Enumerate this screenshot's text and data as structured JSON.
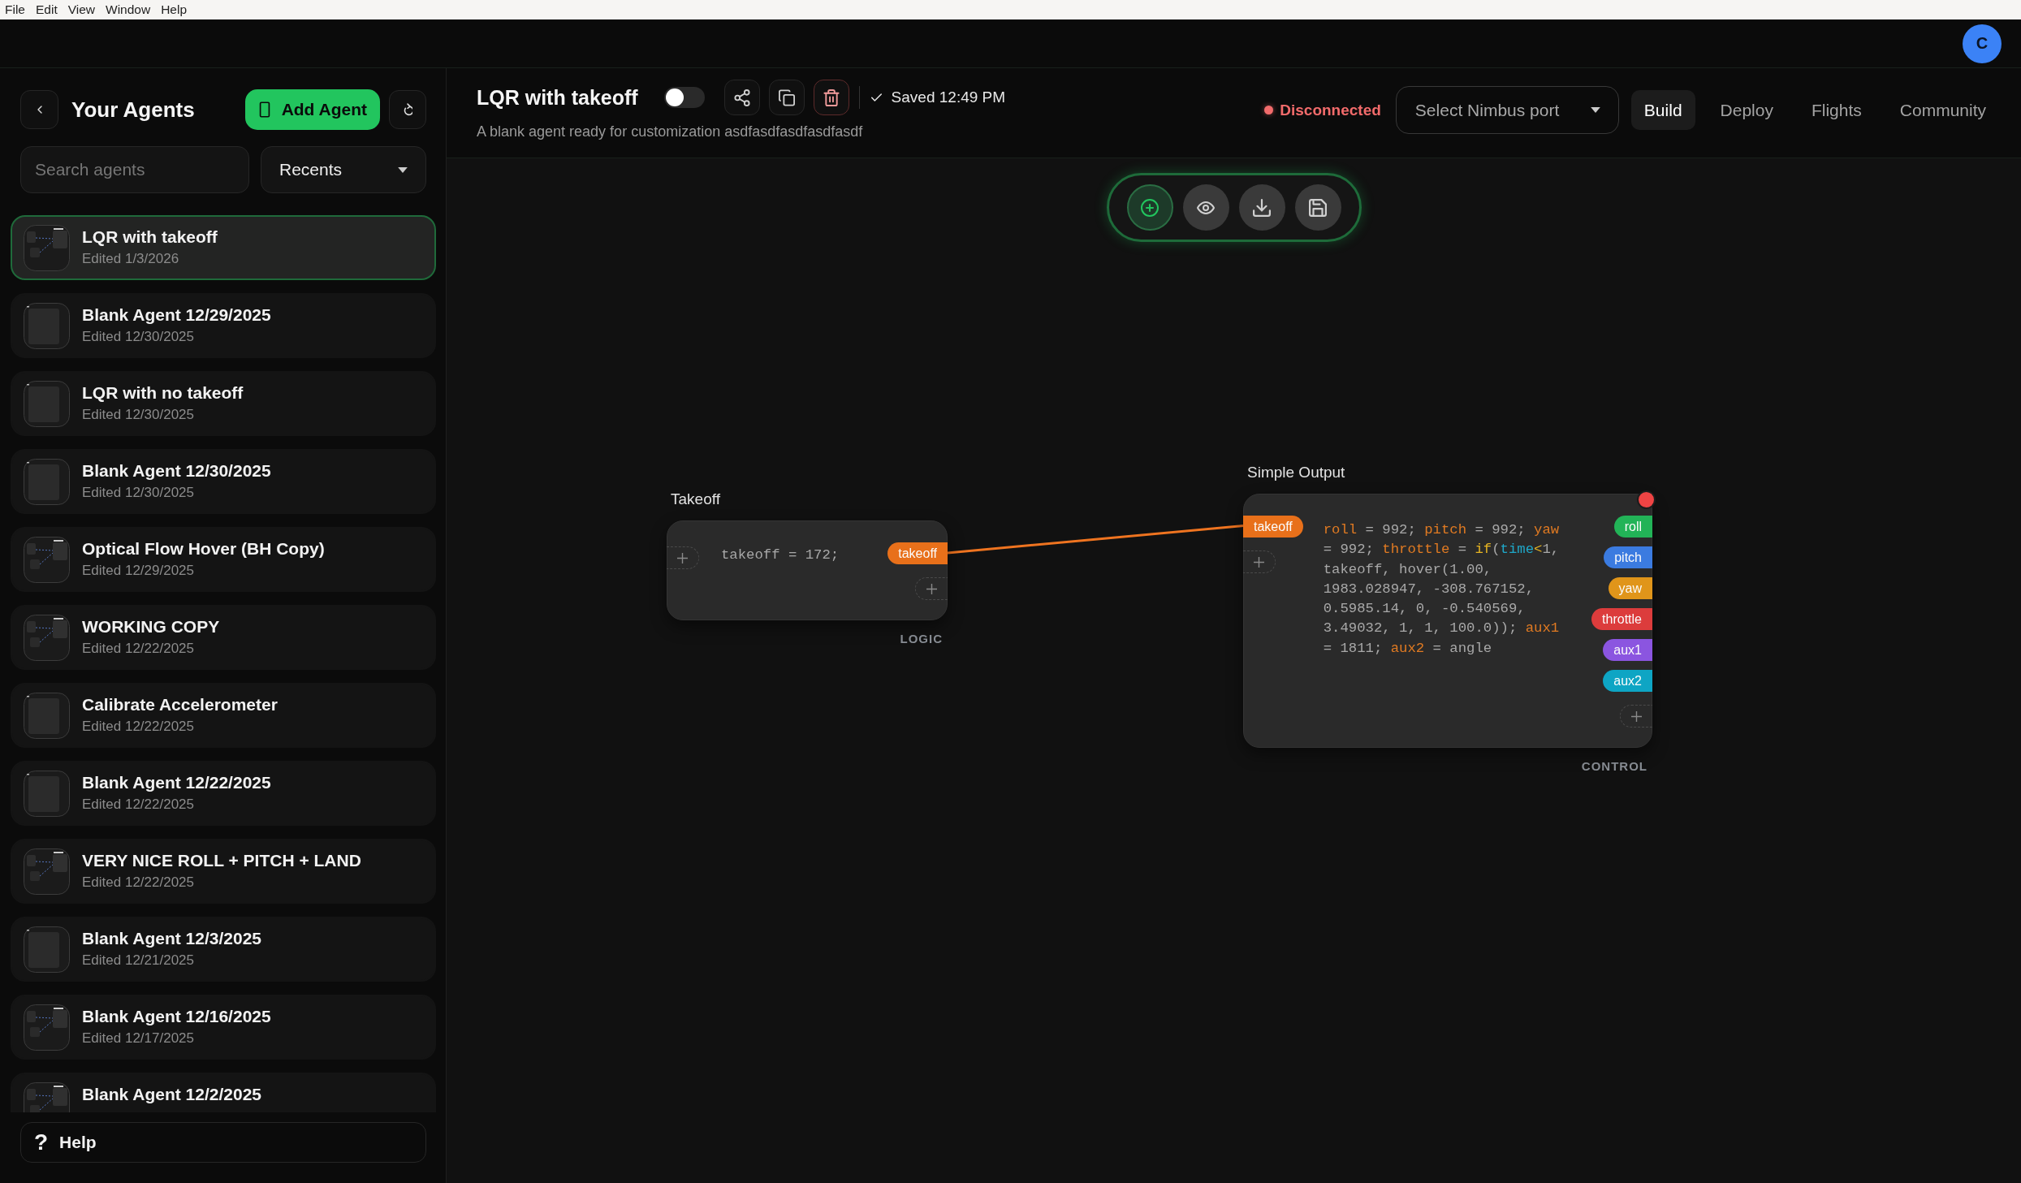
{
  "menu_bar": {
    "items": [
      "File",
      "Edit",
      "View",
      "Window",
      "Help"
    ]
  },
  "account": {
    "avatar": "C"
  },
  "sidebar": {
    "title": "Your Agents",
    "add_button": "Add Agent",
    "search": {
      "placeholder": "Search agents"
    },
    "sort": {
      "value": "Recents"
    },
    "agents": [
      {
        "name": "LQR with takeoff",
        "edited": "Edited 1/3/2026",
        "kind": "graph",
        "selected": true
      },
      {
        "name": "Blank Agent 12/29/2025",
        "edited": "Edited 12/30/2025",
        "kind": "blank",
        "selected": false
      },
      {
        "name": "LQR with no takeoff",
        "edited": "Edited 12/30/2025",
        "kind": "blank",
        "selected": false
      },
      {
        "name": "Blank Agent 12/30/2025",
        "edited": "Edited 12/30/2025",
        "kind": "blank",
        "selected": false
      },
      {
        "name": "Optical Flow Hover (BH Copy)",
        "edited": "Edited 12/29/2025",
        "kind": "graph",
        "selected": false
      },
      {
        "name": "WORKING COPY",
        "edited": "Edited 12/22/2025",
        "kind": "graph",
        "selected": false
      },
      {
        "name": "Calibrate Accelerometer",
        "edited": "Edited 12/22/2025",
        "kind": "blank",
        "selected": false
      },
      {
        "name": "Blank Agent 12/22/2025",
        "edited": "Edited 12/22/2025",
        "kind": "blank",
        "selected": false
      },
      {
        "name": "VERY NICE ROLL + PITCH + LAND",
        "edited": "Edited 12/22/2025",
        "kind": "graph",
        "selected": false
      },
      {
        "name": "Blank Agent 12/3/2025",
        "edited": "Edited 12/21/2025",
        "kind": "blank",
        "selected": false
      },
      {
        "name": "Blank Agent 12/16/2025",
        "edited": "Edited 12/17/2025",
        "kind": "graph",
        "selected": false
      },
      {
        "name": "Blank Agent 12/2/2025",
        "kind": "graph",
        "selected": false
      }
    ],
    "help": {
      "glyph": "?",
      "label": "Help"
    }
  },
  "agent": {
    "title": "LQR with takeoff",
    "enabled": false,
    "saved": "Saved 12:49 PM",
    "description": "A blank agent ready for customization asdfasdfasdfasdfasdf"
  },
  "connection": {
    "status": "Disconnected",
    "connected": false
  },
  "port_select": {
    "placeholder": "Select Nimbus port"
  },
  "tabs": [
    {
      "label": "Build",
      "selected": true
    },
    {
      "label": "Deploy",
      "selected": false
    },
    {
      "label": "Flights",
      "selected": false
    },
    {
      "label": "Community",
      "selected": false
    }
  ],
  "canvas": {
    "nodes": [
      {
        "title": "Takeoff",
        "category": "LOGIC",
        "alert": false,
        "outputs": [
          {
            "label": "takeoff",
            "color": "#e8701a"
          }
        ],
        "code": [
          {
            "kind": "text",
            "text": "takeoff = 172;"
          }
        ]
      },
      {
        "title": "Simple Output",
        "category": "CONTROL",
        "alert": true,
        "inputs": [
          {
            "label": "takeoff",
            "color": "#e8701a"
          }
        ],
        "outputs": [
          {
            "label": "roll",
            "color": "#22b357"
          },
          {
            "label": "pitch",
            "color": "#3b7be0"
          },
          {
            "label": "yaw",
            "color": "#e0951a"
          },
          {
            "label": "throttle",
            "color": "#dc3c3c"
          },
          {
            "label": "aux1",
            "color": "#8b55e0"
          },
          {
            "label": "aux2",
            "color": "#0ea5c4"
          }
        ],
        "code": [
          {
            "kind": "output",
            "text": "roll"
          },
          {
            "kind": "text",
            "text": " = 992; "
          },
          {
            "kind": "output",
            "text": "pitch"
          },
          {
            "kind": "text",
            "text": " = 992; "
          },
          {
            "kind": "output",
            "text": "yaw"
          },
          {
            "kind": "text",
            "text": " = 992; "
          },
          {
            "kind": "output",
            "text": "throttle"
          },
          {
            "kind": "text",
            "text": " = "
          },
          {
            "kind": "keyword",
            "text": "if"
          },
          {
            "kind": "text",
            "text": "("
          },
          {
            "kind": "input",
            "text": "time"
          },
          {
            "kind": "operator",
            "text": "<"
          },
          {
            "kind": "text",
            "text": "1, takeoff, hover(1.00, 1983.028947, -308.767152, 0.5985.14, 0, -0.540569, 3.49032, 1, 1, 100.0)); "
          },
          {
            "kind": "output",
            "text": "aux1"
          },
          {
            "kind": "text",
            "text": " = 1811; "
          },
          {
            "kind": "output",
            "text": "aux2"
          },
          {
            "kind": "text",
            "text": " = angle"
          }
        ]
      }
    ]
  }
}
